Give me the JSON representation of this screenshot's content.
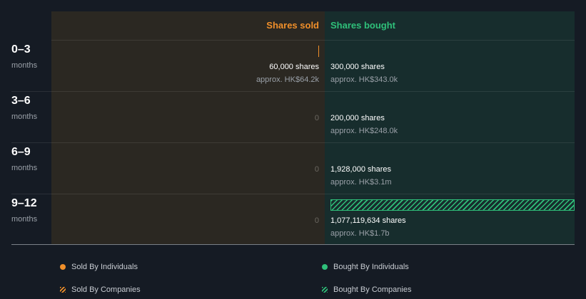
{
  "colors": {
    "sold": "#f08f2a",
    "bought": "#2fc07a",
    "sold_panel": "#2b2822",
    "bought_panel": "#172d2d"
  },
  "headers": {
    "sold": "Shares sold",
    "bought": "Shares bought"
  },
  "chart_data": {
    "type": "bar",
    "orientation": "diverging-horizontal",
    "categories": [
      "0–3",
      "3–6",
      "6–9",
      "9–12"
    ],
    "category_unit": "months",
    "series": [
      {
        "name": "Sold By Individuals",
        "values": [
          60000,
          0,
          0,
          0
        ]
      },
      {
        "name": "Sold By Companies",
        "values": [
          0,
          0,
          0,
          0
        ]
      },
      {
        "name": "Bought By Individuals",
        "values": [
          300000,
          200000,
          1928000,
          0
        ]
      },
      {
        "name": "Bought By Companies",
        "values": [
          0,
          0,
          0,
          1077119634
        ]
      }
    ],
    "sold_labels": [
      {
        "shares": "60,000 shares",
        "approx": "approx. HK$64.2k"
      },
      {
        "zero": "0"
      },
      {
        "zero": "0"
      },
      {
        "zero": "0"
      }
    ],
    "bought_labels": [
      {
        "shares": "300,000 shares",
        "approx": "approx. HK$343.0k"
      },
      {
        "shares": "200,000 shares",
        "approx": "approx. HK$248.0k"
      },
      {
        "shares": "1,928,000 shares",
        "approx": "approx. HK$3.1m"
      },
      {
        "shares": "1,077,119,634 shares",
        "approx": "approx. HK$1.7b"
      }
    ],
    "legend": [
      {
        "label": "Sold By Individuals",
        "style": "dot",
        "color": "#f08f2a"
      },
      {
        "label": "Bought By Individuals",
        "style": "dot",
        "color": "#2fc07a"
      },
      {
        "label": "Sold By Companies",
        "style": "hatch",
        "color": "#f08f2a"
      },
      {
        "label": "Bought By Companies",
        "style": "hatch",
        "color": "#2fc07a"
      }
    ]
  }
}
